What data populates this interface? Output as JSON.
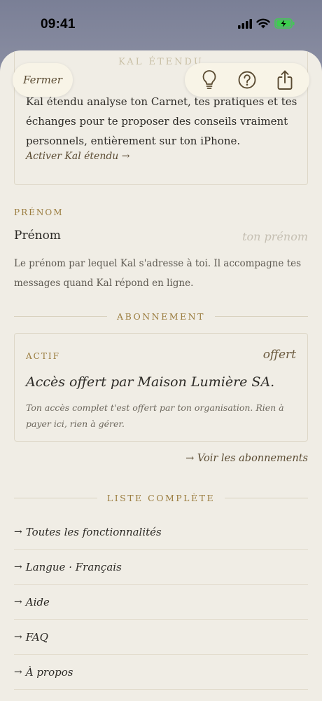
{
  "status_bar": {
    "time": "09:41"
  },
  "sheet": {
    "title": "KAL ÉTENDU",
    "close_label": "Fermer",
    "icons": [
      "lightbulb-icon",
      "help-icon",
      "share-icon"
    ]
  },
  "kal_card": {
    "text": "Kal étendu analyse ton Carnet, tes pratiques et tes échanges pour te proposer des conseils vraiment personnels, entièrement sur ton iPhone.",
    "link": "Activer Kal étendu →"
  },
  "name_section": {
    "label": "PRÉNOM",
    "field_label": "Prénom",
    "placeholder": "ton prénom",
    "help": "Le prénom par lequel Kal s'adresse à toi. Il accompagne tes messages quand Kal répond en ligne."
  },
  "subscription": {
    "heading": "ABONNEMENT",
    "status": "ACTIF",
    "badge": "offert",
    "title": "Accès offert par Maison Lumière SA.",
    "description": "Ton accès complet t'est offert par ton organisation. Rien à payer ici, rien à gérer.",
    "link": "→ Voir les abonnements"
  },
  "full_list": {
    "heading": "LISTE COMPLÈTE",
    "items": [
      {
        "label": "Toutes les fonctionnalités"
      },
      {
        "label": "Langue · Français"
      },
      {
        "label": "Aide"
      },
      {
        "label": "FAQ"
      },
      {
        "label": "À propos"
      }
    ]
  },
  "colors": {
    "accent": "#9a7c3e",
    "background": "#f0ede5",
    "text": "#2c2a26",
    "battery_charging": "#3ccf4e"
  }
}
